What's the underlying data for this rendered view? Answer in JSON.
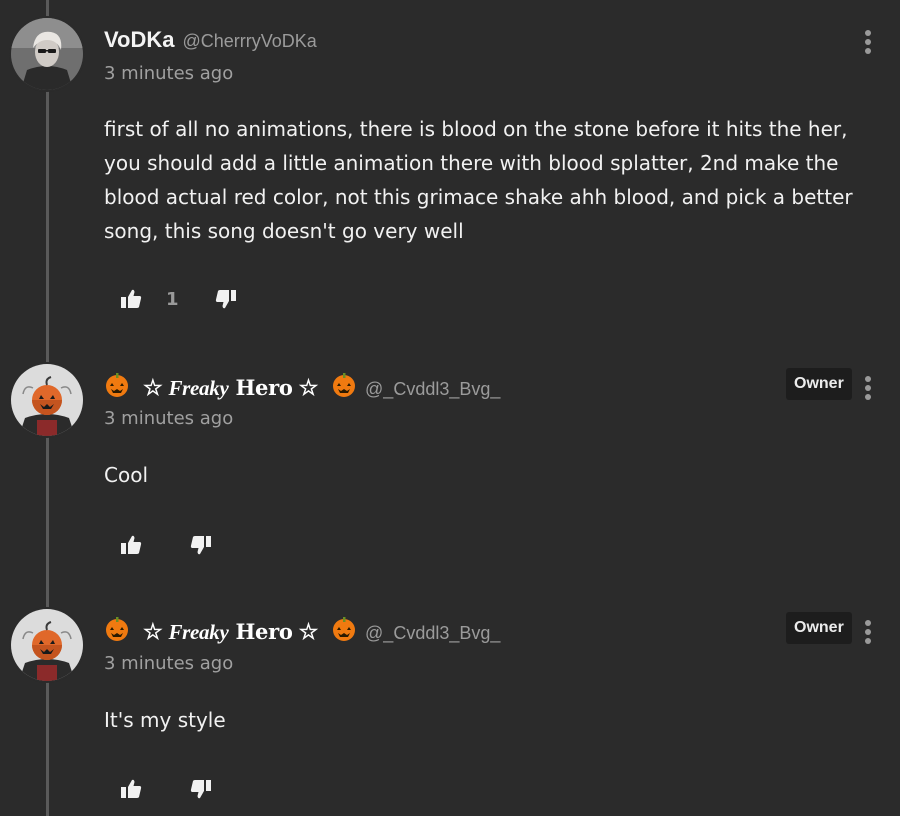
{
  "comments": [
    {
      "author_name": "VoDKa",
      "handle": "@CherrryVoDKa",
      "timestamp": "3 minutes ago",
      "text": "first of all no animations, there is blood on the stone before it hits the her, you should add a little animation there with blood splatter, 2nd make the blood actual red color, not this grimace shake ahh blood, and pick a better song, this song doesn't go very well",
      "like_count": "1"
    },
    {
      "author_name_parts": [
        "☆",
        "Freaky",
        "Hero",
        "☆"
      ],
      "handle": "@_Cvddl3_Bvg_",
      "badge": "Owner",
      "timestamp": "3 minutes ago",
      "text": "Cool"
    },
    {
      "author_name_parts": [
        "☆",
        "Freaky",
        "Hero",
        "☆"
      ],
      "handle": "@_Cvddl3_Bvg_",
      "badge": "Owner",
      "timestamp": "3 minutes ago",
      "text": "It's my style"
    }
  ],
  "icons": {
    "like": "thumbs-up-icon",
    "dislike": "thumbs-down-icon",
    "menu": "more-vertical-icon",
    "pumpkin": "jack-o-lantern-icon"
  },
  "colors": {
    "background": "#2b2b2b",
    "thread_line": "#5a5a5a",
    "badge_bg": "#1d1d1d",
    "muted_text": "#9b9b9b",
    "pumpkin": "#f07a10"
  }
}
